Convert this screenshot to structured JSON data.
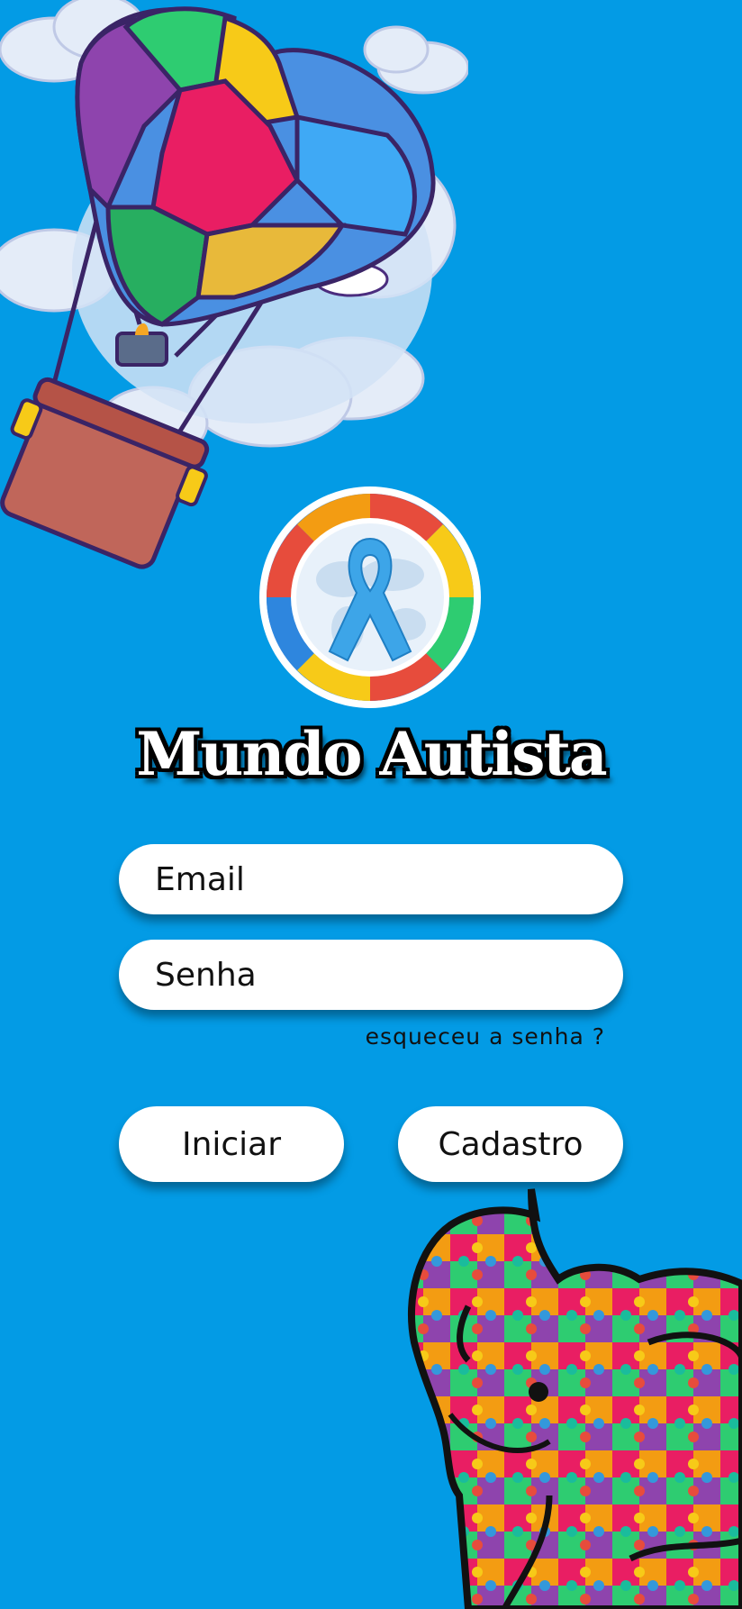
{
  "app": {
    "title": "Mundo Autista"
  },
  "login": {
    "email_placeholder": "Email",
    "password_placeholder": "Senha",
    "forgot_label": "esqueceu a senha ?"
  },
  "actions": {
    "start_label": "Iniciar",
    "signup_label": "Cadastro"
  },
  "icons": {
    "balloon": "hot-air-balloon-icon",
    "logo": "autism-awareness-ribbon-icon",
    "elephant": "puzzle-elephant-icon"
  },
  "colors": {
    "background": "#039BE5",
    "field": "#FFFFFF",
    "ribbon": "#3DA5E8"
  }
}
